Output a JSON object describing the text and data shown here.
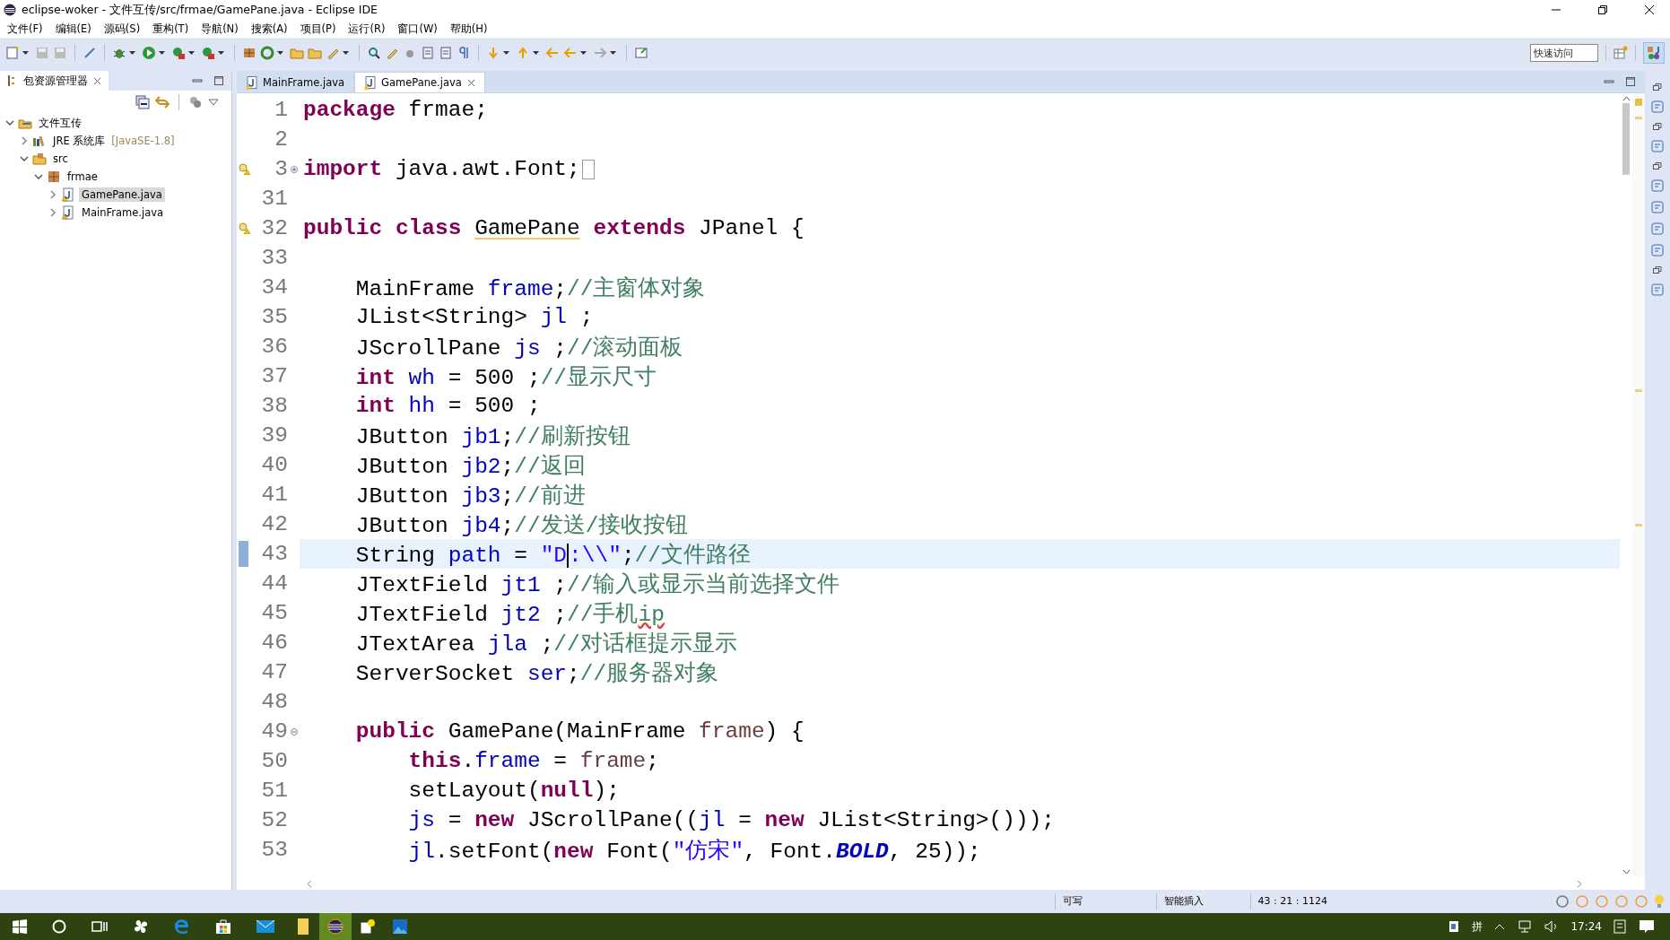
{
  "window": {
    "title": "eclipse-woker - 文件互传/src/frmae/GamePane.java - Eclipse IDE"
  },
  "menu": [
    "文件(F)",
    "编辑(E)",
    "源码(S)",
    "重构(T)",
    "导航(N)",
    "搜索(A)",
    "项目(P)",
    "运行(R)",
    "窗口(W)",
    "帮助(H)"
  ],
  "quick_access": {
    "placeholder": "快速访问"
  },
  "package_explorer": {
    "title": "包资源管理器",
    "tree": [
      {
        "label": "文件互传",
        "kind": "project",
        "expanded": true,
        "selected": false,
        "children": [
          {
            "label": "JRE 系统库",
            "suffix": "[JavaSE-1.8]",
            "kind": "library",
            "expanded": false,
            "selected": false
          },
          {
            "label": "src",
            "kind": "source",
            "expanded": true,
            "selected": false,
            "children": [
              {
                "label": "frmae",
                "kind": "package",
                "expanded": true,
                "selected": false,
                "children": [
                  {
                    "label": "GamePane.java",
                    "kind": "java",
                    "expanded": false,
                    "selected": true
                  },
                  {
                    "label": "MainFrame.java",
                    "kind": "java",
                    "expanded": false,
                    "selected": false
                  }
                ]
              }
            ]
          }
        ]
      }
    ]
  },
  "editor_tabs": [
    {
      "label": "MainFrame.java",
      "selected": false
    },
    {
      "label": "GamePane.java",
      "selected": true
    }
  ],
  "code": [
    {
      "number": "1",
      "current": false,
      "warning": false,
      "tokens": [
        {
          "kind": "kw",
          "text": "package"
        },
        {
          "kind": "plain",
          "text": " frmae;"
        }
      ]
    },
    {
      "number": "2",
      "current": false,
      "warning": false
    },
    {
      "number": "3",
      "current": false,
      "warning": true,
      "expanded": false,
      "tokens": [
        {
          "kind": "kw",
          "text": "import"
        },
        {
          "kind": "plain",
          "text": " java.awt.Font;"
        }
      ]
    },
    {
      "number": "31",
      "current": false,
      "warning": false
    },
    {
      "number": "32",
      "current": false,
      "warning": true,
      "tokens": [
        {
          "kind": "kw",
          "text": "public"
        },
        {
          "kind": "kw",
          "text": " class "
        },
        {
          "kind": "marked",
          "text": "GamePane"
        },
        {
          "kind": "kw",
          "text": " extends"
        },
        {
          "kind": "plain",
          "text": " JPanel {"
        }
      ]
    },
    {
      "number": "33",
      "current": false,
      "warning": false
    },
    {
      "number": "34",
      "current": false,
      "warning": false,
      "tokens": [
        {
          "kind": "plain",
          "text": "    MainFrame "
        },
        {
          "kind": "field",
          "text": "frame"
        },
        {
          "kind": "plain",
          "text": ";"
        },
        {
          "kind": "comment",
          "text": "//主窗体对象"
        }
      ]
    },
    {
      "number": "35",
      "current": false,
      "warning": false,
      "tokens": [
        {
          "kind": "plain",
          "text": "    JList<String> "
        },
        {
          "kind": "field",
          "text": "jl"
        },
        {
          "kind": "plain",
          "text": " ;"
        }
      ]
    },
    {
      "number": "36",
      "current": false,
      "warning": false,
      "tokens": [
        {
          "kind": "plain",
          "text": "    JScrollPane "
        },
        {
          "kind": "field",
          "text": "js"
        },
        {
          "kind": "plain",
          "text": " ;"
        },
        {
          "kind": "comment",
          "text": "//滚动面板"
        }
      ]
    },
    {
      "number": "37",
      "current": false,
      "warning": false,
      "tokens": [
        {
          "kind": "kw",
          "text": "    int"
        },
        {
          "kind": "field",
          "text": " wh"
        },
        {
          "kind": "plain",
          "text": " = 500 ;"
        },
        {
          "kind": "comment",
          "text": "//显示尺寸"
        }
      ]
    },
    {
      "number": "38",
      "current": false,
      "warning": false,
      "tokens": [
        {
          "kind": "kw",
          "text": "    int"
        },
        {
          "kind": "field",
          "text": " hh"
        },
        {
          "kind": "plain",
          "text": " = 500 ;"
        }
      ]
    },
    {
      "number": "39",
      "current": false,
      "warning": false,
      "tokens": [
        {
          "kind": "plain",
          "text": "    JButton "
        },
        {
          "kind": "field",
          "text": "jb1"
        },
        {
          "kind": "plain",
          "text": ";"
        },
        {
          "kind": "comment",
          "text": "//刷新按钮"
        }
      ]
    },
    {
      "number": "40",
      "current": false,
      "warning": false,
      "tokens": [
        {
          "kind": "plain",
          "text": "    JButton "
        },
        {
          "kind": "field",
          "text": "jb2"
        },
        {
          "kind": "plain",
          "text": ";"
        },
        {
          "kind": "comment",
          "text": "//返回"
        }
      ]
    },
    {
      "number": "41",
      "current": false,
      "warning": false,
      "tokens": [
        {
          "kind": "plain",
          "text": "    JButton "
        },
        {
          "kind": "field",
          "text": "jb3"
        },
        {
          "kind": "plain",
          "text": ";"
        },
        {
          "kind": "comment",
          "text": "//前进"
        }
      ]
    },
    {
      "number": "42",
      "current": false,
      "warning": false,
      "tokens": [
        {
          "kind": "plain",
          "text": "    JButton "
        },
        {
          "kind": "field",
          "text": "jb4"
        },
        {
          "kind": "plain",
          "text": ";"
        },
        {
          "kind": "comment",
          "text": "//发送/接收按钮"
        }
      ]
    },
    {
      "number": "43",
      "current": true,
      "warning": false,
      "tokens": [
        {
          "kind": "plain",
          "text": "    String "
        },
        {
          "kind": "field",
          "text": "path"
        },
        {
          "kind": "plain",
          "text": " = "
        },
        {
          "kind": "str",
          "text": "\"D",
          "cursor": true
        },
        {
          "kind": "str",
          "text": ":\\\\\""
        },
        {
          "kind": "plain",
          "text": ";"
        },
        {
          "kind": "comment",
          "text": "//文件路径"
        }
      ]
    },
    {
      "number": "44",
      "current": false,
      "warning": false,
      "tokens": [
        {
          "kind": "plain",
          "text": "    JTextField "
        },
        {
          "kind": "field",
          "text": "jt1"
        },
        {
          "kind": "plain",
          "text": " ;"
        },
        {
          "kind": "comment",
          "text": "//输入或显示当前选择文件"
        }
      ]
    },
    {
      "number": "45",
      "current": false,
      "warning": false,
      "tokens": [
        {
          "kind": "plain",
          "text": "    JTextField "
        },
        {
          "kind": "field",
          "text": "jt2"
        },
        {
          "kind": "plain",
          "text": " ;"
        },
        {
          "kind": "comment",
          "text": "//手机"
        },
        {
          "kind": "spell",
          "text": "ip"
        }
      ]
    },
    {
      "number": "46",
      "current": false,
      "warning": false,
      "tokens": [
        {
          "kind": "plain",
          "text": "    JTextArea "
        },
        {
          "kind": "field",
          "text": "jla"
        },
        {
          "kind": "plain",
          "text": " ;"
        },
        {
          "kind": "comment",
          "text": "//对话框提示显示"
        }
      ]
    },
    {
      "number": "47",
      "current": false,
      "warning": false,
      "tokens": [
        {
          "kind": "plain",
          "text": "    ServerSocket "
        },
        {
          "kind": "field",
          "text": "ser"
        },
        {
          "kind": "plain",
          "text": ";"
        },
        {
          "kind": "comment",
          "text": "//服务器对象"
        }
      ]
    },
    {
      "number": "48",
      "current": false,
      "warning": false
    },
    {
      "number": "49",
      "current": false,
      "warning": false,
      "expanded": true,
      "tokens": [
        {
          "kind": "kw",
          "text": "    public"
        },
        {
          "kind": "plain",
          "text": " GamePane(MainFrame "
        },
        {
          "kind": "param",
          "text": "frame"
        },
        {
          "kind": "plain",
          "text": ") {"
        }
      ]
    },
    {
      "number": "50",
      "current": false,
      "warning": false,
      "tokens": [
        {
          "kind": "kw",
          "text": "        this"
        },
        {
          "kind": "plain",
          "text": "."
        },
        {
          "kind": "field",
          "text": "frame"
        },
        {
          "kind": "plain",
          "text": " = "
        },
        {
          "kind": "param",
          "text": "frame"
        },
        {
          "kind": "plain",
          "text": ";"
        }
      ]
    },
    {
      "number": "51",
      "current": false,
      "warning": false,
      "tokens": [
        {
          "kind": "plain",
          "text": "        setLayout("
        },
        {
          "kind": "kw",
          "text": "null"
        },
        {
          "kind": "plain",
          "text": ");"
        }
      ]
    },
    {
      "number": "52",
      "current": false,
      "warning": false,
      "tokens": [
        {
          "kind": "field",
          "text": "        js"
        },
        {
          "kind": "plain",
          "text": " = "
        },
        {
          "kind": "kw",
          "text": "new"
        },
        {
          "kind": "plain",
          "text": " JScrollPane(("
        },
        {
          "kind": "field",
          "text": "jl"
        },
        {
          "kind": "plain",
          "text": " = "
        },
        {
          "kind": "kw",
          "text": "new"
        },
        {
          "kind": "plain",
          "text": " JList<String>()));"
        }
      ]
    },
    {
      "number": "53",
      "current": false,
      "warning": false,
      "tokens": [
        {
          "kind": "field",
          "text": "        jl"
        },
        {
          "kind": "plain",
          "text": ".setFont("
        },
        {
          "kind": "kw",
          "text": "new"
        },
        {
          "kind": "plain",
          "text": " Font("
        },
        {
          "kind": "str",
          "text": "\"仿宋\""
        },
        {
          "kind": "plain",
          "text": ", Font."
        },
        {
          "kind": "const",
          "text": "BOLD"
        },
        {
          "kind": "plain",
          "text": ", 25));"
        }
      ]
    }
  ],
  "status_bar": {
    "mode": "可写",
    "insert": "智能插入",
    "position": "43 : 21 : 1124"
  },
  "tray": {
    "ime": "拼",
    "time": "17:24"
  }
}
